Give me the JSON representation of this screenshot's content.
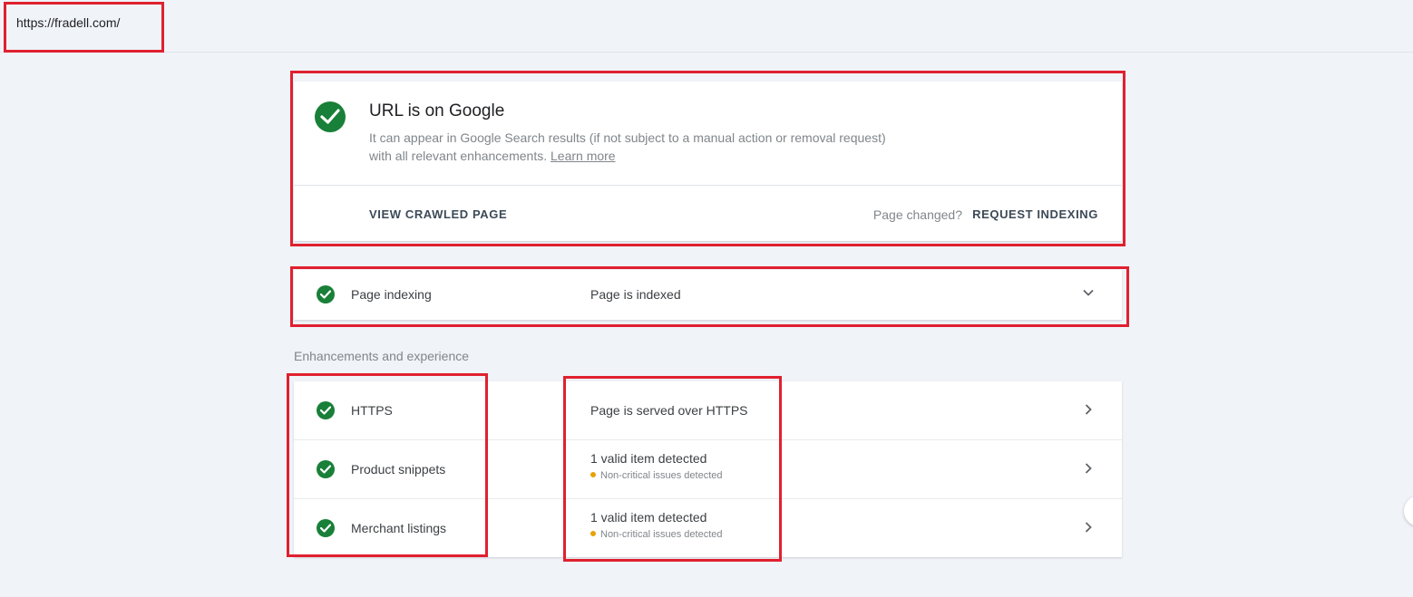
{
  "header": {
    "url": "https://fradell.com/"
  },
  "status": {
    "title": "URL is on Google",
    "description": "It can appear in Google Search results (if not subject to a manual action or removal request) with all relevant enhancements.",
    "learn_more": "Learn more",
    "view_crawled": "VIEW CRAWLED PAGE",
    "page_changed": "Page changed?",
    "request_indexing": "REQUEST INDEXING"
  },
  "indexing": {
    "label": "Page indexing",
    "value": "Page is indexed"
  },
  "enhancements": {
    "heading": "Enhancements and experience",
    "rows": [
      {
        "label": "HTTPS",
        "value": "Page is served over HTTPS",
        "sub": ""
      },
      {
        "label": "Product snippets",
        "value": "1 valid item detected",
        "sub": "Non-critical issues detected"
      },
      {
        "label": "Merchant listings",
        "value": "1 valid item detected",
        "sub": "Non-critical issues detected"
      }
    ]
  },
  "colors": {
    "success": "#188038",
    "warning": "#e8a10a",
    "highlight": "#e0202f"
  }
}
